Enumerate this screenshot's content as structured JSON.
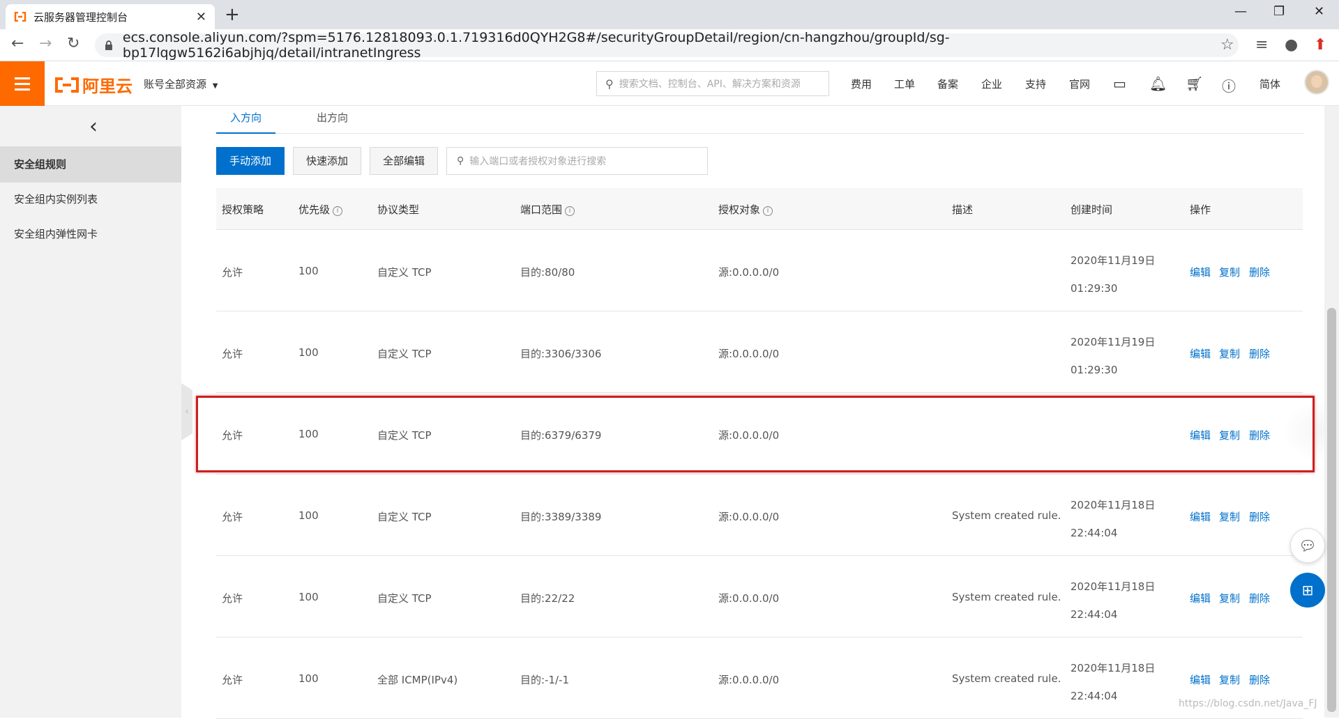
{
  "browser": {
    "tab_title": "云服务器管理控制台",
    "url": "ecs.console.aliyun.com/?spm=5176.12818093.0.1.719316d0QYH2G8#/securityGroupDetail/region/cn-hangzhou/groupId/sg-bp17lqgw5162i6abjhjq/detail/intranetIngress"
  },
  "topnav": {
    "logo_text": "阿里云",
    "account": "账号全部资源",
    "search_placeholder": "搜索文档、控制台、API、解决方案和资源",
    "links": [
      "费用",
      "工单",
      "备案",
      "企业",
      "支持",
      "官网"
    ],
    "lang": "简体"
  },
  "sidebar": {
    "items": [
      "安全组规则",
      "安全组内实例列表",
      "安全组内弹性网卡"
    ]
  },
  "direction_tabs": [
    "入方向",
    "出方向"
  ],
  "toolbar": {
    "manual_add": "手动添加",
    "quick_add": "快速添加",
    "edit_all": "全部编辑",
    "filter_placeholder": "输入端口或者授权对象进行搜索"
  },
  "table": {
    "columns": [
      "授权策略",
      "优先级",
      "协议类型",
      "端口范围",
      "授权对象",
      "描述",
      "创建时间",
      "操作"
    ],
    "actions": [
      "编辑",
      "复制",
      "删除"
    ],
    "rows": [
      {
        "policy": "允许",
        "priority": "100",
        "protocol": "自定义 TCP",
        "port": "目的:80/80",
        "source": "源:0.0.0.0/0",
        "desc": "",
        "date": "2020年11月19日",
        "time": "01:29:30"
      },
      {
        "policy": "允许",
        "priority": "100",
        "protocol": "自定义 TCP",
        "port": "目的:3306/3306",
        "source": "源:0.0.0.0/0",
        "desc": "",
        "date": "2020年11月19日",
        "time": "01:29:30"
      },
      {
        "policy": "允许",
        "priority": "100",
        "protocol": "自定义 TCP",
        "port": "目的:6379/6379",
        "source": "源:0.0.0.0/0",
        "desc": "",
        "date": "",
        "time": ""
      },
      {
        "policy": "允许",
        "priority": "100",
        "protocol": "自定义 TCP",
        "port": "目的:3389/3389",
        "source": "源:0.0.0.0/0",
        "desc": "System created rule.",
        "date": "2020年11月18日",
        "time": "22:44:04"
      },
      {
        "policy": "允许",
        "priority": "100",
        "protocol": "自定义 TCP",
        "port": "目的:22/22",
        "source": "源:0.0.0.0/0",
        "desc": "System created rule.",
        "date": "2020年11月18日",
        "time": "22:44:04"
      },
      {
        "policy": "允许",
        "priority": "100",
        "protocol": "全部 ICMP(IPv4)",
        "port": "目的:-1/-1",
        "source": "源:0.0.0.0/0",
        "desc": "System created rule.",
        "date": "2020年11月18日",
        "time": "22:44:04"
      }
    ]
  },
  "watermark": "https://blog.csdn.net/Java_FJ",
  "colors": {
    "brand": "#ff6a00",
    "primary": "#0070cc",
    "highlight": "#cc1f1f"
  }
}
